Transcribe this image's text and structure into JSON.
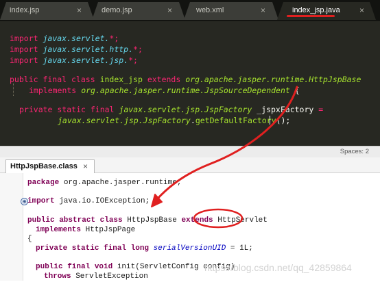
{
  "top_editor": {
    "tabs": [
      {
        "label": "index.jsp",
        "close": "×"
      },
      {
        "label": "demo.jsp",
        "close": "×"
      },
      {
        "label": "web.xml",
        "close": "×"
      },
      {
        "label": "index_jsp.java",
        "close": "×"
      }
    ],
    "code": {
      "l1_kw": "import",
      "l1_pkg": "javax.servlet.",
      "l1_end": "*;",
      "l2_kw": "import",
      "l2_pkg": "javax.servlet.http.",
      "l2_end": "*;",
      "l3_kw": "import",
      "l3_pkg": "javax.servlet.jsp.",
      "l3_end": "*;",
      "l4_mod": "public final class",
      "l4_name": "index_jsp",
      "l4_ext": "extends",
      "l4_base": "org.apache.jasper.runtime.HttpJspBase",
      "l5_impl": "implements",
      "l5_iface": "org.apache.jasper.runtime.JspSourceDependent",
      "l5_brace": "{",
      "l6_mod": "private static final",
      "l6_type": "javax.servlet.jsp.JspFactory",
      "l6_var": "_jspxFactory",
      "l6_eq": "=",
      "l7_type": "javax.servlet.jsp.JspFactory",
      "l7_dot": ".",
      "l7_fn": "getDefaultFactory",
      "l7_end": "();"
    },
    "status_spaces": "Spaces: 2"
  },
  "lower_editor": {
    "tab_label": "HttpJspBase.class",
    "tab_close": "×",
    "fold_symbol": "⊕",
    "code": {
      "l1_kw": "package",
      "l1_rest": " org.apache.jasper.runtime;",
      "l2_kw": "import",
      "l2_rest": " java.io.IOException;",
      "l3_kw": "public abstract class",
      "l3_rest": " HttpJspBase ",
      "l3_ext": "extends",
      "l3_base": " HttpServlet",
      "l4_kw": "implements",
      "l4_rest": " HttpJspPage",
      "l5_brace": "{",
      "l6_kw": "private static final long",
      "l6_field": "serialVersionUID",
      "l6_rest": " = 1L;",
      "l7_kw": "public final void",
      "l7_rest": " init(ServletConfig config)",
      "l8_kw": "throws",
      "l8_rest": " ServletException"
    }
  },
  "watermark": "https://blog.csdn.net/qq_42859864",
  "colors": {
    "annotation": "#e02020",
    "editor_bg": "#272822",
    "keyword": "#f92672"
  }
}
